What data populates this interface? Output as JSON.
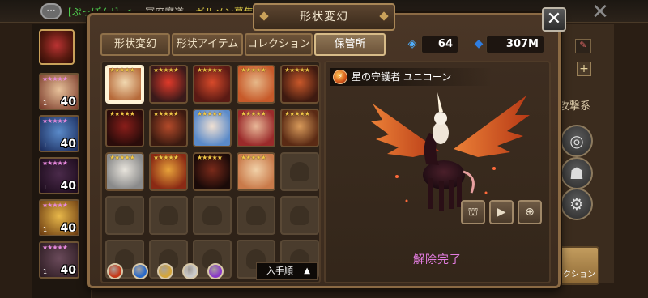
{
  "background": {
    "chat_channel": "[ぷっぽん!]",
    "chat_place": "冥府魔道",
    "chat_message": "ギルメン募集",
    "monster_levels": [
      "40",
      "40",
      "40",
      "40",
      "40"
    ],
    "monster_small_numbers": [
      "1",
      "1",
      "1",
      "1",
      "1"
    ],
    "right_label": "攻撃系",
    "collection_button": "クション"
  },
  "dialog": {
    "title": "形状変幻",
    "close_icon": "close-icon",
    "tabs": [
      {
        "label": "形状変幻",
        "active": false
      },
      {
        "label": "形状アイテム",
        "active": false
      },
      {
        "label": "コレクション",
        "active": false
      },
      {
        "label": "保管所",
        "active": true
      }
    ],
    "crystals": "64",
    "mana": "307M",
    "grid": {
      "rows": [
        [
          {
            "name": "unicorn-skin",
            "stars": "★★★★★",
            "colors": [
              "#f1d8b0",
              "#b66a3a"
            ],
            "selected": true
          },
          {
            "name": "red-hood-skin",
            "stars": "★★★★★",
            "colors": [
              "#e03a2a",
              "#3a1a1a"
            ]
          },
          {
            "name": "fire-knight-skin",
            "stars": "★★★★★",
            "colors": [
              "#d84a2a",
              "#5a1a14"
            ]
          },
          {
            "name": "elf-skin",
            "stars": "★★★★★",
            "colors": [
              "#e6b889",
              "#c75a2a"
            ]
          },
          {
            "name": "monk-skin",
            "stars": "★★★★★",
            "colors": [
              "#c9582a",
              "#3e1a10"
            ]
          }
        ],
        [
          {
            "name": "dragon-skin",
            "stars": "★★★★★",
            "colors": [
              "#8a1e1a",
              "#2a0c0a"
            ]
          },
          {
            "name": "wolf-skin",
            "stars": "★★★★★",
            "colors": [
              "#b44a2a",
              "#3a1a10"
            ]
          },
          {
            "name": "sorceress-skin",
            "stars": "★★★★★",
            "colors": [
              "#f0e0d2",
              "#5a8ac9"
            ]
          },
          {
            "name": "dancer-skin",
            "stars": "★★★★★",
            "colors": [
              "#e9b898",
              "#9a2a2a"
            ]
          },
          {
            "name": "warrior-skin",
            "stars": "★★★★★",
            "colors": [
              "#d89a5a",
              "#5a2a14"
            ]
          }
        ],
        [
          {
            "name": "armor-skin",
            "stars": "★★★★★",
            "colors": [
              "#e8e4dc",
              "#8a8a8a"
            ]
          },
          {
            "name": "beast-skin",
            "stars": "★★★★★",
            "colors": [
              "#e8a33a",
              "#8a2a14"
            ]
          },
          {
            "name": "demon-skin",
            "stars": "★★★★★",
            "colors": [
              "#7a2a1a",
              "#1a0a08"
            ]
          },
          {
            "name": "sage-skin",
            "stars": "★★★★★",
            "colors": [
              "#f1d1a8",
              "#c97a4a"
            ]
          },
          {
            "name": "empty"
          }
        ],
        [
          {
            "name": "empty"
          },
          {
            "name": "empty"
          },
          {
            "name": "empty"
          },
          {
            "name": "empty"
          },
          {
            "name": "empty"
          }
        ],
        [
          {
            "name": "empty"
          },
          {
            "name": "empty"
          },
          {
            "name": "empty"
          },
          {
            "name": "empty"
          },
          {
            "name": "empty"
          }
        ]
      ]
    },
    "filters": [
      {
        "name": "fire-filter-icon",
        "color": "#c63a1a"
      },
      {
        "name": "water-filter-icon",
        "color": "#2a6ac9"
      },
      {
        "name": "wind-filter-icon",
        "color": "#d4a53a"
      },
      {
        "name": "light-filter-icon",
        "color": "#c9c9c9"
      },
      {
        "name": "dark-filter-icon",
        "color": "#8a3ac9"
      }
    ],
    "sort_label": "入手順",
    "selected_name": "星の守護者 ユニコーン",
    "status": "解除完了",
    "action_icons": [
      "summon-icon",
      "video-icon",
      "zoom-icon"
    ]
  }
}
